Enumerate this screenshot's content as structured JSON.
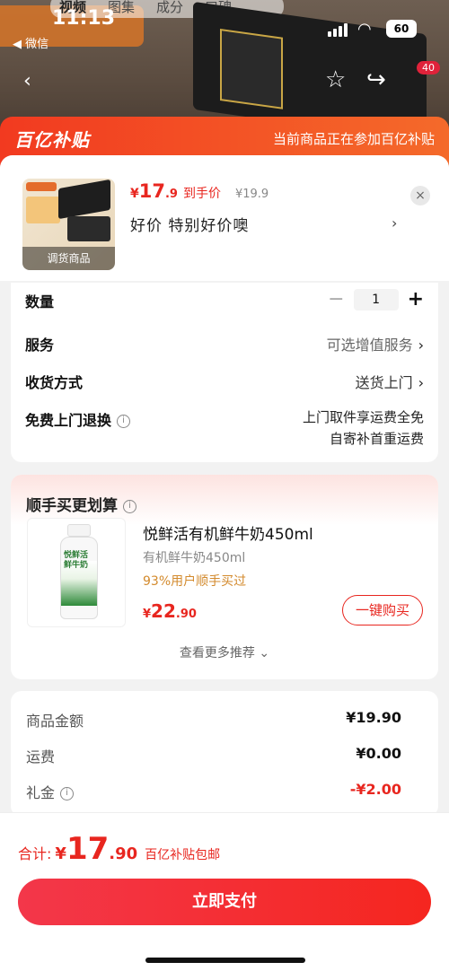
{
  "status_bar": {
    "time": "11:13",
    "back_label": "◀ 微信",
    "battery": "60"
  },
  "backdrop": {
    "tabs": [
      "视频",
      "图集",
      "成分",
      "口碑"
    ],
    "active_tab": 0,
    "badge": "40"
  },
  "banner": {
    "logo": "百亿补贴",
    "note": "当前商品正在参加百亿补贴"
  },
  "product": {
    "thumb_caption": "调货商品",
    "currency": "¥",
    "price_int": "17",
    "price_dec": ".9",
    "price_tag": "到手价",
    "original_price": "¥19.9",
    "slogan": "好价  特别好价噢",
    "slogan_arrow": "›",
    "close": "×"
  },
  "options": {
    "quantity_label": "数量",
    "quantity_value": "1",
    "minus": "−",
    "plus": "+",
    "service_label": "服务",
    "service_value": "可选增值服务",
    "delivery_label": "收货方式",
    "delivery_value": "送货上门",
    "return_label": "免费上门退换",
    "return_line1": "上门取件享运费全免",
    "return_line2": "自寄补首重运费",
    "chevron": "›",
    "info": "i"
  },
  "recommend": {
    "title": "顺手买更划算",
    "bottle_text": "悦鲜活\n鲜牛奶",
    "name": "悦鲜活有机鲜牛奶450ml",
    "spec": "有机鲜牛奶450ml",
    "bought": "93%用户顺手买过",
    "price_cur": "¥",
    "price_int": "22",
    "price_dec": ".90",
    "buy_label": "一键购买",
    "more_label": "查看更多推荐 ⌄"
  },
  "summary": {
    "items": [
      {
        "label": "商品金额",
        "value": "¥19.90"
      },
      {
        "label": "运费",
        "value": "¥0.00"
      },
      {
        "label": "礼金",
        "value": "-¥2.00"
      }
    ]
  },
  "footer": {
    "total_label": "合计:",
    "total_cur": "¥",
    "total_int": "17",
    "total_dec": ".90",
    "total_note": "百亿补贴包邮",
    "pay_label": "立即支付"
  },
  "colors": {
    "brand_red": "#e8261f",
    "banner_start": "#f23a20",
    "banner_end": "#f46a2a"
  }
}
